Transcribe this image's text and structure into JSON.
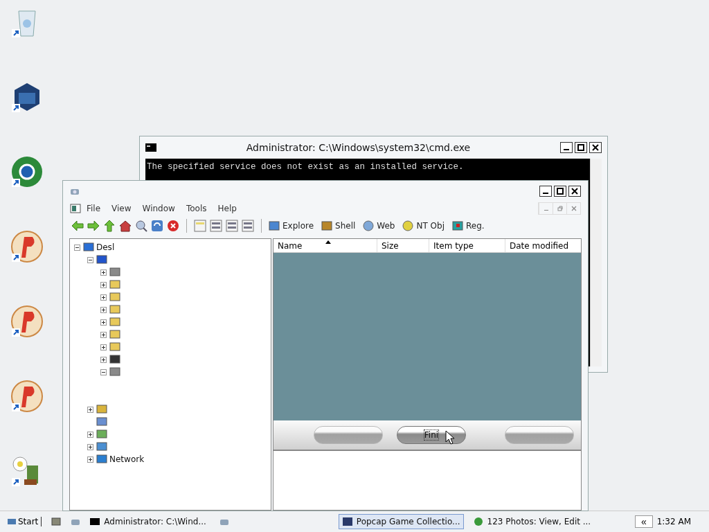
{
  "desktop_icons": [
    {
      "kind": "bin"
    },
    {
      "kind": "cube"
    },
    {
      "kind": "globe"
    },
    {
      "kind": "badge"
    },
    {
      "kind": "badge"
    },
    {
      "kind": "badge"
    },
    {
      "kind": "flower"
    }
  ],
  "cmd_window": {
    "title": "Administrator: C:\\Windows\\system32\\cmd.exe",
    "output": "The specified service does not exist as an installed service."
  },
  "explorer_window": {
    "menu": [
      "File",
      "View",
      "Window",
      "Tools",
      "Help"
    ],
    "toolbar_links": [
      {
        "kind": "folder",
        "label": "Explore"
      },
      {
        "kind": "shell",
        "label": "Shell"
      },
      {
        "kind": "globe",
        "label": "Web"
      },
      {
        "kind": "ball",
        "label": "NT Obj"
      },
      {
        "kind": "grid",
        "label": "Reg."
      }
    ],
    "tree": [
      {
        "kind": "desktop",
        "label": "Desl",
        "expanded": true,
        "children": [
          {
            "kind": "computer",
            "expanded": true,
            "children": [
              {
                "kind": "drive",
                "expanded": false
              },
              {
                "kind": "folder",
                "expanded": false
              },
              {
                "kind": "folder",
                "expanded": false
              },
              {
                "kind": "folder",
                "expanded": false
              },
              {
                "kind": "folder",
                "expanded": false
              },
              {
                "kind": "folder",
                "expanded": false
              },
              {
                "kind": "folder",
                "expanded": false
              },
              {
                "kind": "dot",
                "expanded": false
              },
              {
                "kind": "drive",
                "expanded": true
              }
            ]
          },
          {
            "kind": "user",
            "expanded": false
          },
          {
            "kind": "doc"
          },
          {
            "kind": "control",
            "expanded": false
          },
          {
            "kind": "panel",
            "expanded": false
          },
          {
            "kind": "network",
            "label": "Network",
            "expanded": false
          }
        ]
      }
    ],
    "columns": [
      {
        "label": "Name",
        "sorted": true
      },
      {
        "label": "Size",
        "sorted": false
      },
      {
        "label": "Item type",
        "sorted": false
      },
      {
        "label": "Date modified",
        "sorted": false
      }
    ],
    "wizard_buttons": [
      {
        "disabled": true
      },
      {
        "label": "Fini",
        "disabled": false
      },
      {
        "disabled": true
      }
    ]
  },
  "taskbar": {
    "start": "Start",
    "tasks": [
      {
        "kind": "console",
        "label": "Administrator: C:\\Wind...",
        "selected": false
      },
      {
        "kind": "blank",
        "selected": false
      },
      {
        "kind": "app",
        "label": "Popcap Game Collectio...",
        "selected": true
      },
      {
        "kind": "photo",
        "label": "123 Photos: View, Edit ...",
        "selected": false
      }
    ],
    "chevron": "«",
    "clock": "1:32 AM"
  }
}
